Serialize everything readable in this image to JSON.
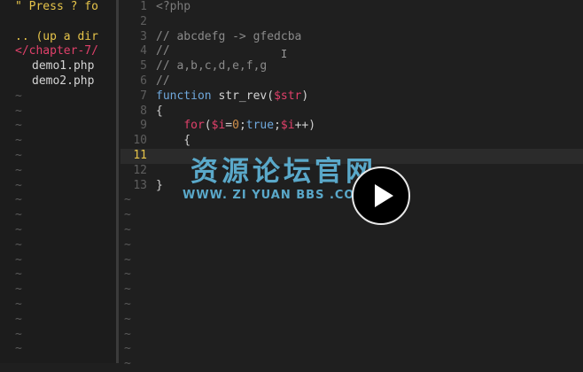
{
  "file_tree": {
    "help_line": "\" Press ? fo",
    "up_dir": ".. (up a dir",
    "current_dir": "</chapter-7/",
    "files": [
      "demo1.php",
      "demo2.php"
    ],
    "tilde": "~"
  },
  "editor": {
    "tilde": "~",
    "cursor_line": 11,
    "lines": [
      {
        "num": "1",
        "tokens": [
          {
            "t": "<?php",
            "c": "c-tag"
          }
        ]
      },
      {
        "num": "2",
        "tokens": []
      },
      {
        "num": "3",
        "tokens": [
          {
            "t": "// abcdefg -> gfedcba",
            "c": "c-com"
          }
        ]
      },
      {
        "num": "4",
        "tokens": [
          {
            "t": "//",
            "c": "c-com"
          }
        ]
      },
      {
        "num": "5",
        "tokens": [
          {
            "t": "// a,b,c,d,e,f,g",
            "c": "c-com"
          }
        ]
      },
      {
        "num": "6",
        "tokens": [
          {
            "t": "//",
            "c": "c-com"
          }
        ]
      },
      {
        "num": "7",
        "tokens": [
          {
            "t": "function",
            "c": "c-kw"
          },
          {
            "t": " str_rev(",
            "c": "c-fn"
          },
          {
            "t": "$str",
            "c": "c-var"
          },
          {
            "t": ")",
            "c": "c-fn"
          }
        ]
      },
      {
        "num": "8",
        "tokens": [
          {
            "t": "{",
            "c": "c-punc"
          }
        ]
      },
      {
        "num": "9",
        "tokens": [
          {
            "t": "    ",
            "c": "c-punc"
          },
          {
            "t": "for",
            "c": "c-ctrl"
          },
          {
            "t": "(",
            "c": "c-punc"
          },
          {
            "t": "$i",
            "c": "c-var"
          },
          {
            "t": "=",
            "c": "c-punc"
          },
          {
            "t": "0",
            "c": "c-num"
          },
          {
            "t": ";",
            "c": "c-punc"
          },
          {
            "t": "true",
            "c": "c-bool"
          },
          {
            "t": ";",
            "c": "c-punc"
          },
          {
            "t": "$i",
            "c": "c-var"
          },
          {
            "t": "++",
            "c": "c-punc"
          },
          {
            "t": ")",
            "c": "c-punc"
          }
        ]
      },
      {
        "num": "10",
        "tokens": [
          {
            "t": "    {",
            "c": "c-punc"
          }
        ]
      },
      {
        "num": "11",
        "tokens": []
      },
      {
        "num": "12",
        "tokens": []
      },
      {
        "num": "13",
        "tokens": [
          {
            "t": "}",
            "c": "c-punc"
          }
        ]
      }
    ]
  },
  "watermark": {
    "title": "资源论坛官网",
    "url": "WWW. ZI YUAN BBS .COM"
  },
  "colors": {
    "background": "#1f1f1f",
    "accent_yellow": "#e6c44a",
    "accent_pink": "#e0406a",
    "keyword_blue": "#6fa8dc",
    "watermark_blue": "#5fb4d8"
  },
  "icons": {
    "play": "play-icon",
    "text_cursor": "ibeam-cursor-icon"
  }
}
